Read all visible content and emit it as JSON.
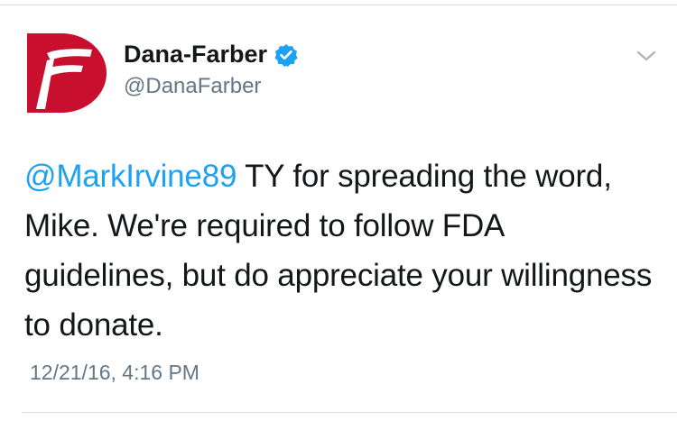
{
  "tweet": {
    "author": {
      "display_name": "Dana-Farber",
      "handle": "@DanaFarber",
      "verified": true,
      "avatar_icon": "dana-farber-logo-icon",
      "brand_color": "#c8102e"
    },
    "menu_icon": "chevron-down-icon",
    "text": {
      "mention": "@MarkIrvine89",
      "body": " TY for spreading the word, Mike. We're required to follow FDA guidelines, but do appreciate your willingness to donate."
    },
    "timestamp": "12/21/16, 4:16 PM",
    "colors": {
      "link": "#1da1f2",
      "verified_badge": "#1da1f2",
      "secondary_text": "#657786"
    }
  }
}
